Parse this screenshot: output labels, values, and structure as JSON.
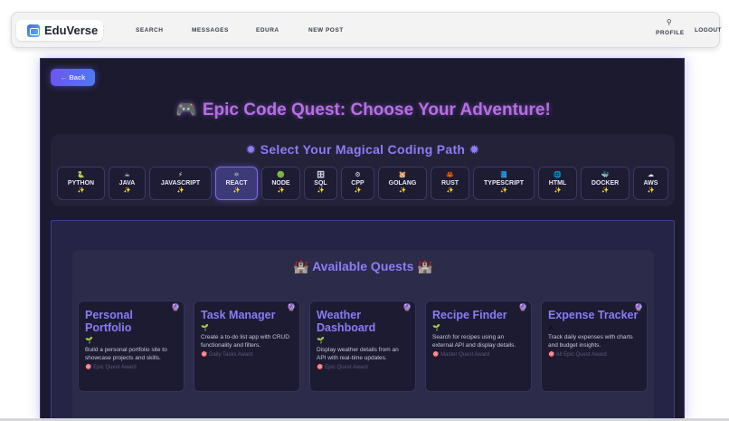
{
  "navbar": {
    "brand": "EduVerse",
    "brand_icon": "laptop-icon",
    "links": [
      "SEARCH",
      "MESSAGES",
      "EDURA",
      "NEW POST"
    ],
    "profile_label": "PROFILE",
    "logout_label": "LOGOUT"
  },
  "app": {
    "back_label": "← Back",
    "title": "Epic Code Quest: Choose Your Adventure!",
    "path_panel": {
      "title": "Select Your Magical Coding Path"
    },
    "languages": [
      {
        "label": "PYTHON",
        "icon": "🐍"
      },
      {
        "label": "JAVA",
        "icon": "☕"
      },
      {
        "label": "JAVASCRIPT",
        "icon": "⚡"
      },
      {
        "label": "REACT",
        "icon": "⚛"
      },
      {
        "label": "NODE",
        "icon": "🟢"
      },
      {
        "label": "SQL",
        "icon": "🗄"
      },
      {
        "label": "CPP",
        "icon": "⚙"
      },
      {
        "label": "GOLANG",
        "icon": "🐹"
      },
      {
        "label": "RUST",
        "icon": "🦀"
      },
      {
        "label": "TYPESCRIPT",
        "icon": "📘"
      },
      {
        "label": "HTML",
        "icon": "🌐"
      },
      {
        "label": "DOCKER",
        "icon": "🐳"
      },
      {
        "label": "AWS",
        "icon": "☁"
      }
    ],
    "active_language": "REACT",
    "quests_title": "Available Quests",
    "quests": [
      {
        "title": "Personal Portfolio",
        "description": "Build a personal portfolio site to showcase projects and skills.",
        "reward": "🎯 Epic Quest Award"
      },
      {
        "title": "Task Manager",
        "description": "Create a to-do list app with CRUD functionality and filters.",
        "reward": "🎯 Daily Tasks Award"
      },
      {
        "title": "Weather Dashboard",
        "description": "Display weather details from an API with real-time updates.",
        "reward": "🎯 Epic Quest Award"
      },
      {
        "title": "Recipe Finder",
        "description": "Search for recipes using an external API and display details.",
        "reward": "🎯 Master Quest Award"
      },
      {
        "title": "Expense Tracker",
        "description": "Track daily expenses with charts and budget insights.",
        "reward": "🎯 All Epic Quest Award"
      }
    ]
  },
  "colors": {
    "accent": "#8b7cf6",
    "title_gradient": "#b66fe6",
    "panel_bg": "#1b1a2e"
  }
}
